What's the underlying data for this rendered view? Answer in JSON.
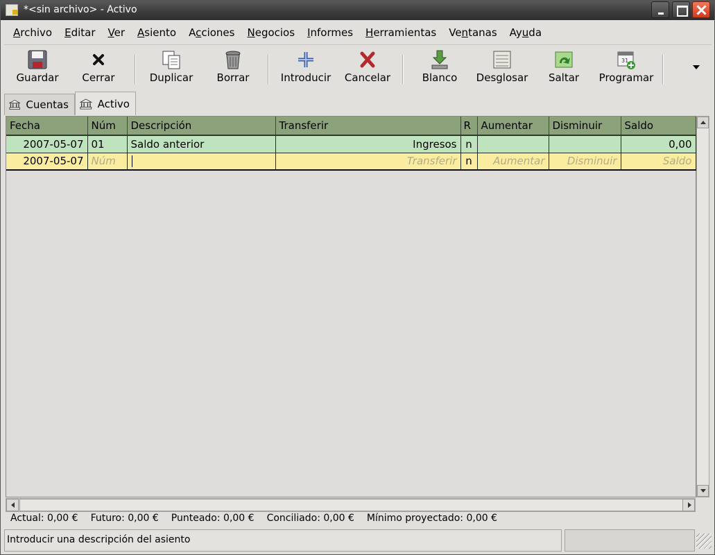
{
  "window": {
    "title": "*<sin archivo> - Activo"
  },
  "menu": [
    {
      "first": "A",
      "rest": "rchivo"
    },
    {
      "first": "E",
      "rest": "ditar"
    },
    {
      "first": "V",
      "rest": "er"
    },
    {
      "first": "A",
      "rest": "siento"
    },
    {
      "pre": "A",
      "first": "c",
      "rest": "ciones"
    },
    {
      "first": "N",
      "rest": "egocios"
    },
    {
      "first": "I",
      "rest": "nformes"
    },
    {
      "first": "H",
      "rest": "erramientas"
    },
    {
      "pre": "Ve",
      "first": "n",
      "rest": "tanas"
    },
    {
      "pre": "Ay",
      "first": "u",
      "rest": "da"
    }
  ],
  "toolbar": {
    "guardar": "Guardar",
    "cerrar": "Cerrar",
    "duplicar": "Duplicar",
    "borrar": "Borrar",
    "introducir": "Introducir",
    "cancelar": "Cancelar",
    "blanco": "Blanco",
    "desglosar": "Desglosar",
    "saltar": "Saltar",
    "programar": "Programar"
  },
  "tabs": {
    "cuentas": "Cuentas",
    "activo": "Activo"
  },
  "register": {
    "headers": {
      "fecha": "Fecha",
      "num": "Núm",
      "descripcion": "Descripción",
      "transferir": "Transferir",
      "r": "R",
      "aumentar": "Aumentar",
      "disminuir": "Disminuir",
      "saldo": "Saldo"
    },
    "rows": [
      {
        "fecha": "2007-05-07",
        "num": "01",
        "descripcion": "Saldo anterior",
        "transferir": "Ingresos",
        "r": "n",
        "aumentar": "",
        "disminuir": "",
        "saldo": "0,00"
      },
      {
        "fecha": "2007-05-07",
        "num": "",
        "num_placeholder": "Núm",
        "descripcion": "",
        "transferir": "",
        "transferir_placeholder": "Transferir",
        "r": "n",
        "aumentar_placeholder": "Aumentar",
        "disminuir_placeholder": "Disminuir",
        "saldo_placeholder": "Saldo"
      }
    ]
  },
  "summary": {
    "actual": "Actual: 0,00 €",
    "futuro": "Futuro: 0,00 €",
    "punteado": "Punteado: 0,00 €",
    "conciliado": "Conciliado: 0,00 €",
    "minimo": "Mínimo proyectado: 0,00 €"
  },
  "statusbar": {
    "message": "Introducir una descripción del asiento"
  },
  "colors": {
    "header_bg": "#8ba27b",
    "row_committed": "#bfe3bd",
    "row_current": "#fbeda0",
    "close_button": "#e0512f"
  }
}
